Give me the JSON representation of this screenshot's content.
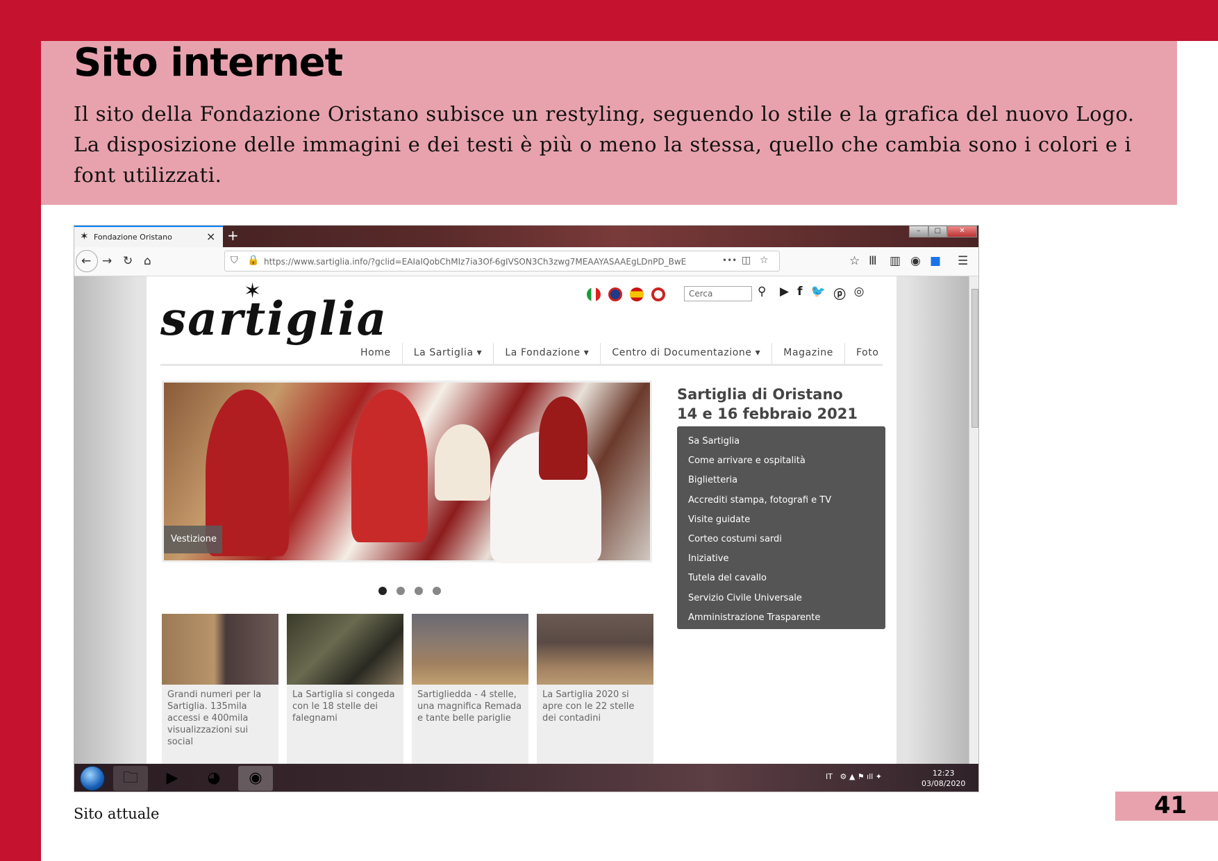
{
  "page": {
    "title": "Sito internet",
    "intro_line1": "Il sito della Fondazione Oristano subisce un restyling, seguendo lo stile e la grafica del nuovo Logo.",
    "intro_line2": "La disposizione delle immagini e dei testi è più o meno la stessa, quello che cambia sono i colori e i font utilizzati.",
    "caption": "Sito attuale",
    "page_number": "41"
  },
  "browser": {
    "tab_title": "Fondazione Oristano",
    "tab_icon": "star-icon",
    "new_tab_symbol": "+",
    "url": "https://www.sartiglia.info/?gclid=EAIaIQobChMIz7ia3Of-6gIVSON3Ch3zwg7MEAAYASAAEgLDnPD_BwE",
    "page_actions_symbol": "•••"
  },
  "site": {
    "logo": "sartiglia",
    "search_placeholder": "Cerca",
    "menu": [
      "Home",
      "La Sartiglia ▾",
      "La Fondazione ▾",
      "Centro di Documentazione ▾",
      "Magazine",
      "Foto"
    ],
    "hero_caption": "Vestizione",
    "slider_dots": 4,
    "slider_active": 0,
    "sidebar_title_line1": "Sartiglia di Oristano",
    "sidebar_title_line2": "14 e 16 febbraio 2021",
    "sidebar_links": [
      "Sa Sartiglia",
      "Come arrivare e ospitalità",
      "Biglietteria",
      "Accrediti stampa, fotografi e TV",
      "Visite guidate",
      "Corteo costumi sardi",
      "Iniziative",
      "Tutela del cavallo",
      "Servizio Civile Universale",
      "Amministrazione Trasparente"
    ],
    "news": [
      {
        "text": "Grandi numeri per la Sartiglia. 135mila accessi e 400mila visualizzazioni sui social"
      },
      {
        "text": "La Sartiglia si congeda con le 18 stelle dei falegnami"
      },
      {
        "text": "Sartigliedda - 4 stelle, una magnifica Remada e tante belle pariglie"
      },
      {
        "text": "La Sartiglia 2020 si apre con le 22 stelle dei contadini"
      }
    ]
  },
  "taskbar": {
    "language": "IT",
    "time": "12:23",
    "date": "03/08/2020"
  },
  "colors": {
    "frame_red": "#c4122f",
    "band_pink": "#e8a2ad",
    "side_menu_bg": "#555555"
  }
}
